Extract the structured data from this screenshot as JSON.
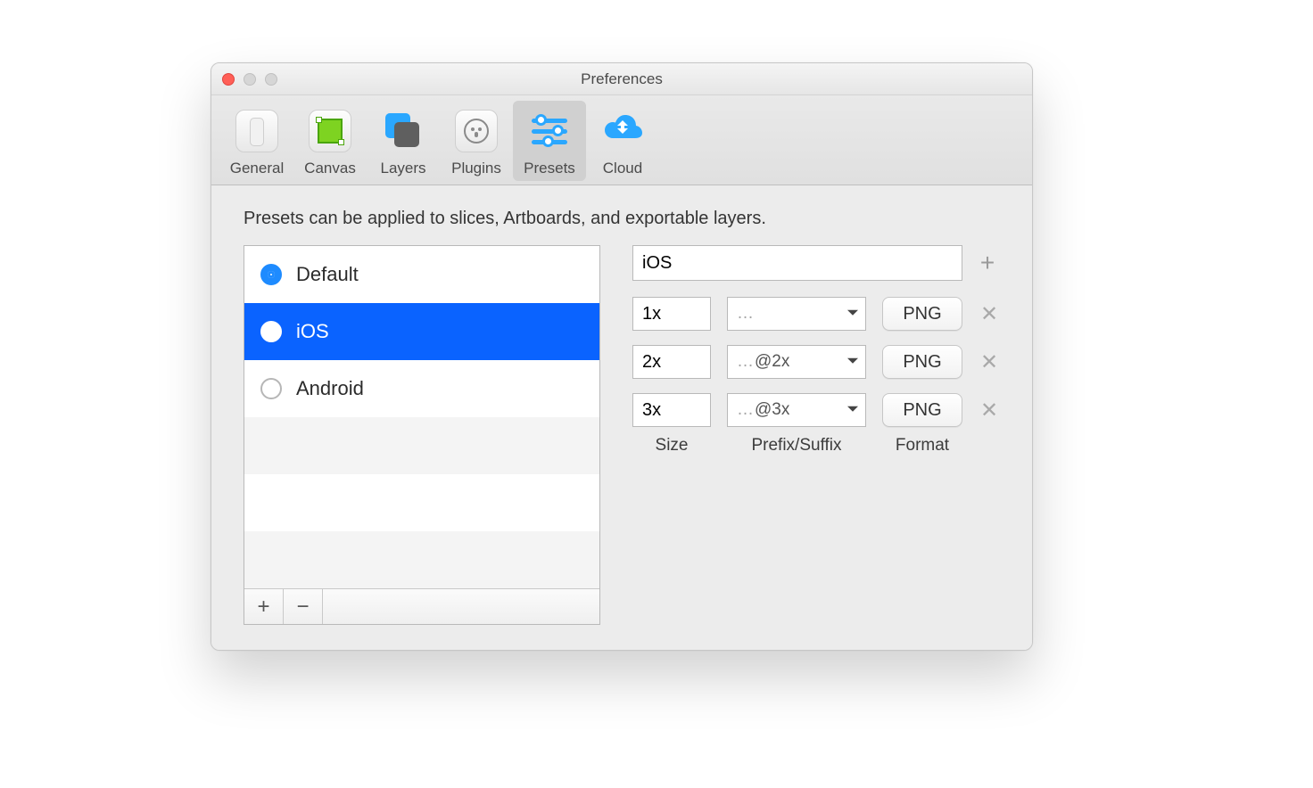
{
  "window": {
    "title": "Preferences"
  },
  "toolbar": {
    "items": [
      {
        "id": "general",
        "label": "General"
      },
      {
        "id": "canvas",
        "label": "Canvas"
      },
      {
        "id": "layers",
        "label": "Layers"
      },
      {
        "id": "plugins",
        "label": "Plugins"
      },
      {
        "id": "presets",
        "label": "Presets"
      },
      {
        "id": "cloud",
        "label": "Cloud"
      }
    ],
    "selected": "presets"
  },
  "content": {
    "description": "Presets can be applied to slices, Artboards, and exportable layers.",
    "presets": {
      "items": [
        {
          "label": "Default",
          "checked": true,
          "selected": false
        },
        {
          "label": "iOS",
          "checked": false,
          "selected": true
        },
        {
          "label": "Android",
          "checked": false,
          "selected": false
        }
      ],
      "total_rows": 6,
      "footer": {
        "add": "+",
        "remove": "−"
      }
    },
    "details": {
      "name": "iOS",
      "add_row": "+",
      "rows": [
        {
          "size": "1x",
          "suffix_placeholder": "…",
          "suffix": "",
          "format": "PNG"
        },
        {
          "size": "2x",
          "suffix_placeholder": "…",
          "suffix": "@2x",
          "format": "PNG"
        },
        {
          "size": "3x",
          "suffix_placeholder": "…",
          "suffix": "@3x",
          "format": "PNG"
        }
      ],
      "columns": {
        "size": "Size",
        "suffix": "Prefix/Suffix",
        "format": "Format"
      },
      "remove_row": "✕"
    }
  }
}
